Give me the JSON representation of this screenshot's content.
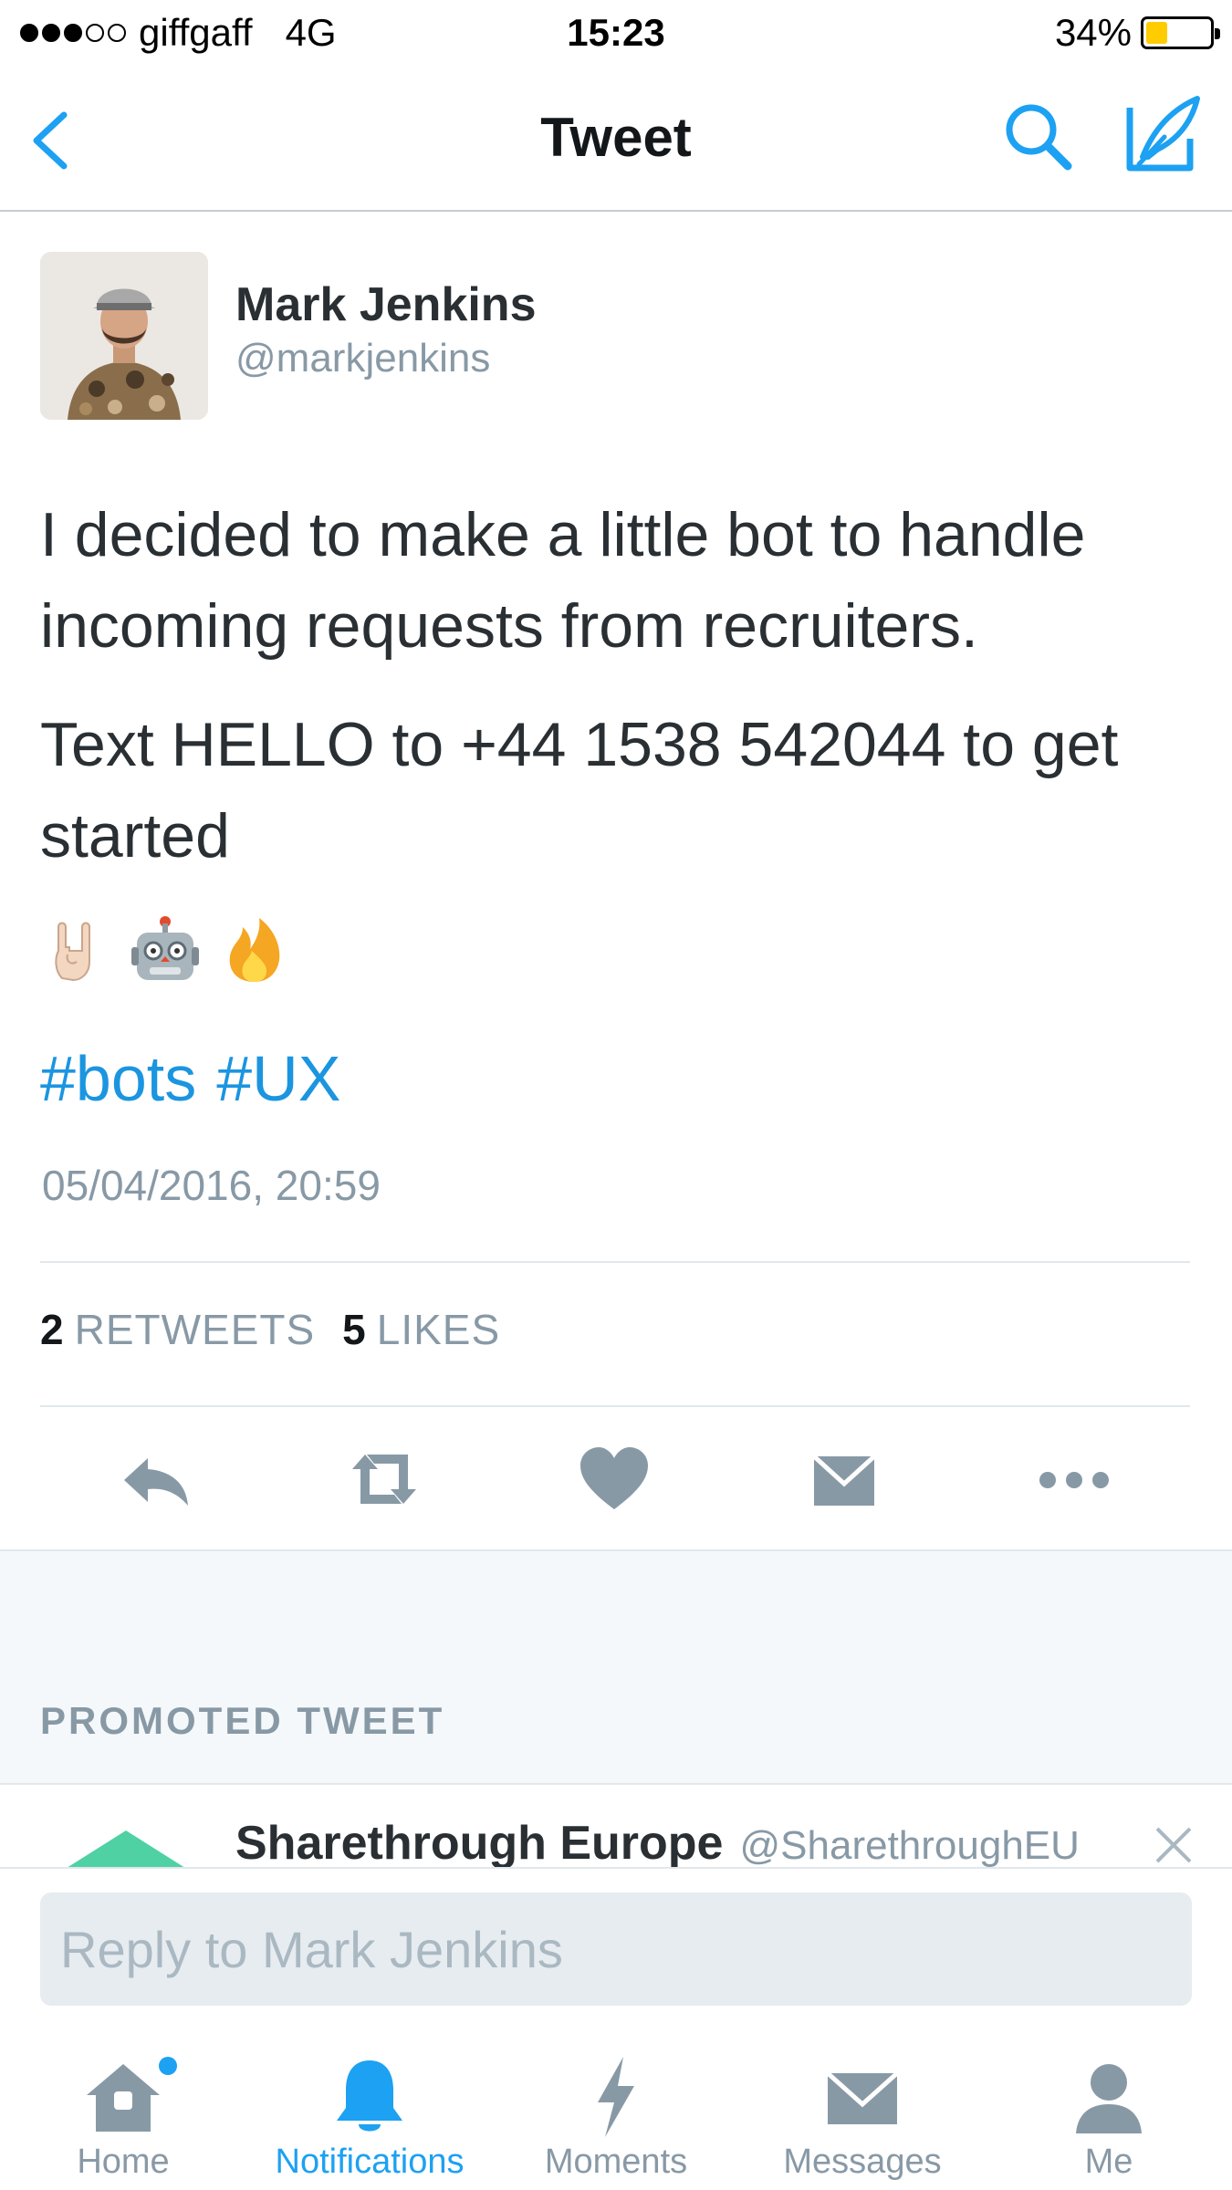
{
  "status_bar": {
    "carrier": "giffgaff",
    "network": "4G",
    "time": "15:23",
    "battery_percent": "34%",
    "battery_level": 0.34,
    "signal_bars_filled": 3,
    "signal_bars_total": 5
  },
  "nav": {
    "title": "Tweet",
    "back_icon": "chevron-left-icon",
    "search_icon": "search-icon",
    "compose_icon": "compose-icon",
    "accent_color": "#1da1f2"
  },
  "tweet": {
    "author_name": "Mark Jenkins",
    "author_handle": "@markjenkins",
    "paragraphs": [
      "I decided to make a little bot to handle incoming requests from recruiters.",
      "Text HELLO to +44 1538 542044 to get started"
    ],
    "emojis": [
      "sign-of-the-horns",
      "robot-face",
      "fire"
    ],
    "hashtags": [
      "#bots",
      "#UX"
    ],
    "timestamp": "05/04/2016, 20:59",
    "retweets_count": "2",
    "retweets_label": "RETWEETS",
    "likes_count": "5",
    "likes_label": "LIKES",
    "actions": [
      "reply-icon",
      "retweet-icon",
      "like-icon",
      "direct-message-icon",
      "more-icon"
    ]
  },
  "promoted": {
    "label": "PROMOTED TWEET",
    "name": "Sharethrough Europe",
    "handle": "@SharethroughEU"
  },
  "reply": {
    "placeholder": "Reply to Mark Jenkins"
  },
  "tabs": [
    {
      "label": "Home",
      "icon": "home-icon",
      "has_badge": true
    },
    {
      "label": "Notifications",
      "icon": "bell-icon",
      "active": true
    },
    {
      "label": "Moments",
      "icon": "lightning-icon"
    },
    {
      "label": "Messages",
      "icon": "envelope-icon"
    },
    {
      "label": "Me",
      "icon": "person-icon"
    }
  ]
}
